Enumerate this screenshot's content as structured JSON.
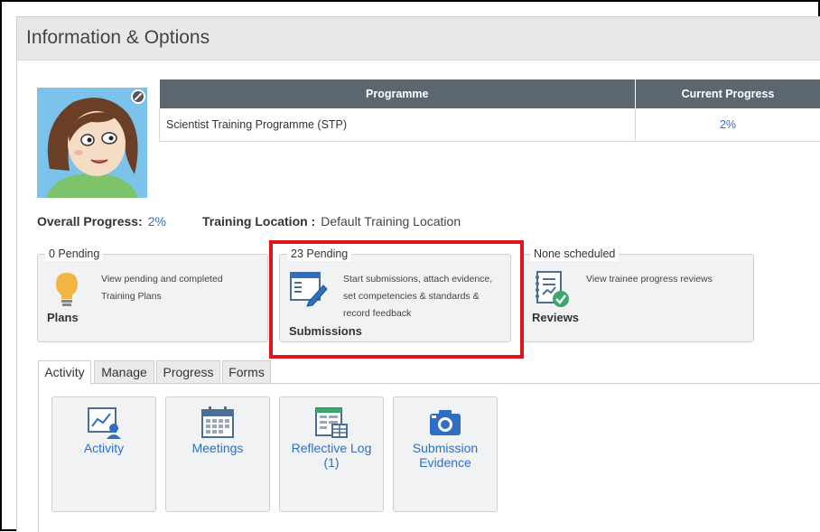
{
  "panel": {
    "title": "Information & Options"
  },
  "programme_table": {
    "headers": [
      "Programme",
      "Current Progress"
    ],
    "rows": [
      {
        "programme": "Scientist Training Programme (STP)",
        "progress": "2%"
      }
    ]
  },
  "overall_progress": {
    "label": "Overall Progress:",
    "value": "2%"
  },
  "training_location": {
    "label": "Training Location :",
    "value": "Default Training Location"
  },
  "cards": {
    "plans": {
      "legend": "0 Pending",
      "desc1": "View pending and completed",
      "desc2": "Training Plans",
      "label": "Plans"
    },
    "submissions": {
      "legend": "23 Pending",
      "desc1": "Start submissions, attach evidence,",
      "desc2": "set competencies & standards &",
      "desc3": "record feedback",
      "label": "Submissions"
    },
    "reviews": {
      "legend": "None scheduled",
      "desc1": "View trainee progress reviews",
      "label": "Reviews"
    }
  },
  "tabs": [
    "Activity",
    "Manage",
    "Progress",
    "Forms"
  ],
  "tiles": {
    "activity": {
      "label": "Activity"
    },
    "meetings": {
      "label": "Meetings"
    },
    "reflective_log": {
      "line1": "Reflective Log",
      "line2": "(1)"
    },
    "submission_evidence": {
      "line1": "Submission",
      "line2": "Evidence"
    }
  },
  "colors": {
    "accent": "#2e6fc4",
    "header": "#5c6670",
    "highlight": "#e0141b",
    "avatar_bg": "#7bc3ea"
  }
}
